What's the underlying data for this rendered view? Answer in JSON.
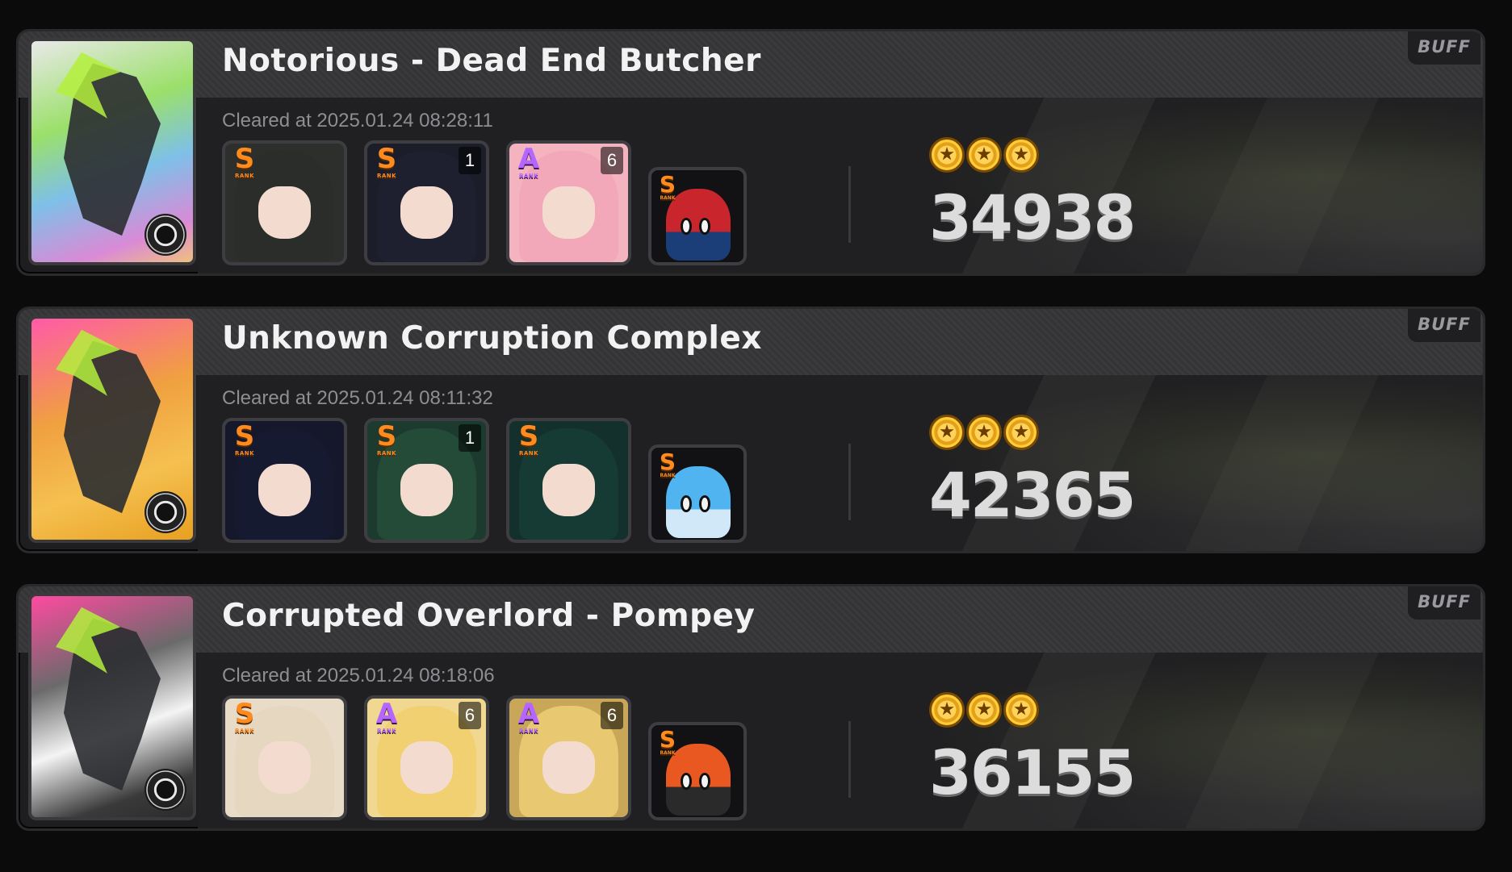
{
  "colors": {
    "rank_s": "#ff8a1e",
    "rank_a": "#b566ff",
    "accent_green": "#b4f03c",
    "star_gold": "#ffcc3a"
  },
  "records": [
    {
      "title": "Notorious - Dead End Butcher",
      "buff_label": "BUFF",
      "cleared": "Cleared at 2025.01.24 08:28:11",
      "score": "34938",
      "stars": 3,
      "boss_palette": {
        "bg": "linear-gradient(160deg,#e9e9e9 0%,#9be06a 35%,#7ec0e8 60%,#d98ad6 85%,#f0c080 100%)"
      },
      "agents": [
        {
          "rank": "S",
          "rank_sub": "RANK",
          "level": "",
          "palette": "#2c2f2c",
          "hair": "#2a2d2a"
        },
        {
          "rank": "S",
          "rank_sub": "RANK",
          "level": "1",
          "palette": "#1b1d28",
          "hair": "#1e2030"
        },
        {
          "rank": "A",
          "rank_sub": "RANK",
          "level": "6",
          "palette": "#f3b4c0",
          "hair": "#f2a8b8"
        }
      ],
      "bangboo": {
        "rank": "S",
        "rank_sub": "RANK",
        "body": "#c8262c",
        "accent": "#1b3e78"
      }
    },
    {
      "title": "Unknown Corruption Complex",
      "buff_label": "BUFF",
      "cleared": "Cleared at 2025.01.24 08:11:32",
      "score": "42365",
      "stars": 3,
      "boss_palette": {
        "bg": "linear-gradient(160deg,#ff5aa8 0%,#f0a040 40%,#f5c050 70%,#e8a020 100%)"
      },
      "agents": [
        {
          "rank": "S",
          "rank_sub": "RANK",
          "level": "",
          "palette": "#15182a",
          "hair": "#151a30"
        },
        {
          "rank": "S",
          "rank_sub": "RANK",
          "level": "1",
          "palette": "#1c3a2e",
          "hair": "#244a38"
        },
        {
          "rank": "S",
          "rank_sub": "RANK",
          "level": "",
          "palette": "#13302c",
          "hair": "#163a34"
        }
      ],
      "bangboo": {
        "rank": "S",
        "rank_sub": "RANK",
        "body": "#4fb4f0",
        "accent": "#d0e8f8"
      }
    },
    {
      "title": "Corrupted Overlord - Pompey",
      "buff_label": "BUFF",
      "cleared": "Cleared at 2025.01.24 08:18:06",
      "score": "36155",
      "stars": 3,
      "boss_palette": {
        "bg": "linear-gradient(160deg,#ff4aa0 0%,#6a6a6a 35%,#f4f4f4 60%,#3a3a3a 85%,#2a2a2a 100%)"
      },
      "agents": [
        {
          "rank": "S",
          "rank_sub": "RANK",
          "level": "",
          "palette": "#e8dcc8",
          "hair": "#e6d8c0"
        },
        {
          "rank": "A",
          "rank_sub": "RANK",
          "level": "6",
          "palette": "#f0d890",
          "hair": "#f0d070"
        },
        {
          "rank": "A",
          "rank_sub": "RANK",
          "level": "6",
          "palette": "#c8a858",
          "hair": "#e8c870"
        }
      ],
      "bangboo": {
        "rank": "S",
        "rank_sub": "RANK",
        "body": "#e85820",
        "accent": "#2a2a2a"
      }
    }
  ]
}
